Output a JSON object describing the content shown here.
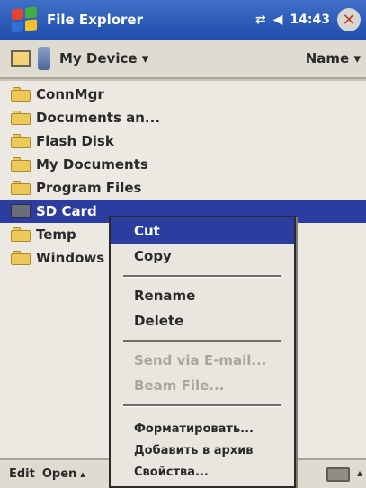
{
  "titlebar": {
    "title": "File Explorer",
    "time": "14:43",
    "close_glyph": "✕",
    "icons": [
      "windows-start-flag-icon",
      "connectivity-icon",
      "volume-icon",
      "close-icon"
    ]
  },
  "location": {
    "device": "My Device",
    "device_arrow": "▾",
    "sort": "Name",
    "sort_arrow": "▾"
  },
  "files": [
    {
      "name": "ConnMgr",
      "icon": "folder-icon"
    },
    {
      "name": "Documents an...",
      "icon": "folder-icon"
    },
    {
      "name": "Flash Disk",
      "icon": "folder-icon"
    },
    {
      "name": "My Documents",
      "icon": "folder-icon"
    },
    {
      "name": "Program Files",
      "icon": "folder-icon"
    },
    {
      "name": "SD Card",
      "icon": "sd-card-icon"
    },
    {
      "name": "Temp",
      "icon": "folder-icon"
    },
    {
      "name": "Windows",
      "icon": "folder-icon"
    }
  ],
  "selected_file": "SD Card",
  "bottombar": {
    "edit": "Edit",
    "open": "Open",
    "arrow": "▴",
    "keyboard_arrow": "▴"
  },
  "context_menu": {
    "cut": "Cut",
    "copy": "Copy",
    "rename": "Rename",
    "delete": "Delete",
    "send_email": "Send via E-mail...",
    "beam": "Beam File...",
    "format": "Форматировать...",
    "add_archive": "Добавить в архив",
    "properties": "Свойства..."
  },
  "colors": {
    "title_bar": "#2b55b5",
    "selection": "#2b3ea0",
    "folder": "#ecc95a",
    "menu_bg": "#e8e6df",
    "disabled_text": "#a8a69f"
  }
}
